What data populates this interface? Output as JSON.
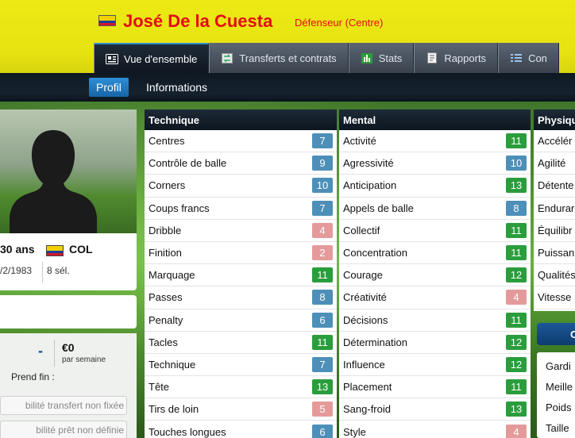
{
  "colors": {
    "good": "#2a9d3c",
    "mid": "#4d8fb8",
    "low": "#e49a9a",
    "header": "#e9e614",
    "name": "#e30b14"
  },
  "header": {
    "name": "José De la Cuesta",
    "position": "Défenseur (Centre)"
  },
  "tabs": [
    {
      "label": "Vue d'ensemble",
      "icon": "overview-icon"
    },
    {
      "label": "Transferts et contrats",
      "icon": "transfer-icon"
    },
    {
      "label": "Stats",
      "icon": "stats-icon"
    },
    {
      "label": "Rapports",
      "icon": "report-icon"
    },
    {
      "label": "Con",
      "icon": "list-icon"
    }
  ],
  "subtabs": [
    "Profil",
    "Informations"
  ],
  "profile": {
    "age": "30 ans",
    "nationality": "COL",
    "dob": "/2/1983",
    "caps": "8 sél."
  },
  "contract": {
    "value": "-",
    "wage": "€0",
    "wage_unit": "par semaine",
    "expires": "Prend fin :",
    "transfer_status": "bilité transfert non fixée",
    "loan_status": "bilité prêt non définie"
  },
  "technique": {
    "title": "Technique",
    "rows": [
      {
        "label": "Centres",
        "value": "7",
        "level": "mid"
      },
      {
        "label": "Contrôle de balle",
        "value": "9",
        "level": "mid"
      },
      {
        "label": "Corners",
        "value": "10",
        "level": "mid"
      },
      {
        "label": "Coups francs",
        "value": "7",
        "level": "mid"
      },
      {
        "label": "Dribble",
        "value": "4",
        "level": "low"
      },
      {
        "label": "Finition",
        "value": "2",
        "level": "low"
      },
      {
        "label": "Marquage",
        "value": "11",
        "level": "good"
      },
      {
        "label": "Passes",
        "value": "8",
        "level": "mid"
      },
      {
        "label": "Penalty",
        "value": "6",
        "level": "mid"
      },
      {
        "label": "Tacles",
        "value": "11",
        "level": "good"
      },
      {
        "label": "Technique",
        "value": "7",
        "level": "mid"
      },
      {
        "label": "Tête",
        "value": "13",
        "level": "good"
      },
      {
        "label": "Tirs de loin",
        "value": "5",
        "level": "low"
      },
      {
        "label": "Touches longues",
        "value": "6",
        "level": "mid"
      }
    ]
  },
  "mental": {
    "title": "Mental",
    "rows": [
      {
        "label": "Activité",
        "value": "11",
        "level": "good"
      },
      {
        "label": "Agressivité",
        "value": "10",
        "level": "mid"
      },
      {
        "label": "Anticipation",
        "value": "13",
        "level": "good"
      },
      {
        "label": "Appels de balle",
        "value": "8",
        "level": "mid"
      },
      {
        "label": "Collectif",
        "value": "11",
        "level": "good"
      },
      {
        "label": "Concentration",
        "value": "11",
        "level": "good"
      },
      {
        "label": "Courage",
        "value": "12",
        "level": "good"
      },
      {
        "label": "Créativité",
        "value": "4",
        "level": "low"
      },
      {
        "label": "Décisions",
        "value": "11",
        "level": "good"
      },
      {
        "label": "Détermination",
        "value": "12",
        "level": "good"
      },
      {
        "label": "Influence",
        "value": "12",
        "level": "good"
      },
      {
        "label": "Placement",
        "value": "11",
        "level": "good"
      },
      {
        "label": "Sang-froid",
        "value": "13",
        "level": "good"
      },
      {
        "label": "Style",
        "value": "4",
        "level": "low"
      }
    ]
  },
  "physique": {
    "title": "Physiqu",
    "rows": [
      "Accélér",
      "Agilité",
      "Détente",
      "Endurar",
      "Équilibr",
      "Puissan",
      "Qualités",
      "Vitesse"
    ]
  },
  "positions_button": "C",
  "positions": [
    "Gardi",
    "Meille",
    "Poids",
    "Taille"
  ]
}
